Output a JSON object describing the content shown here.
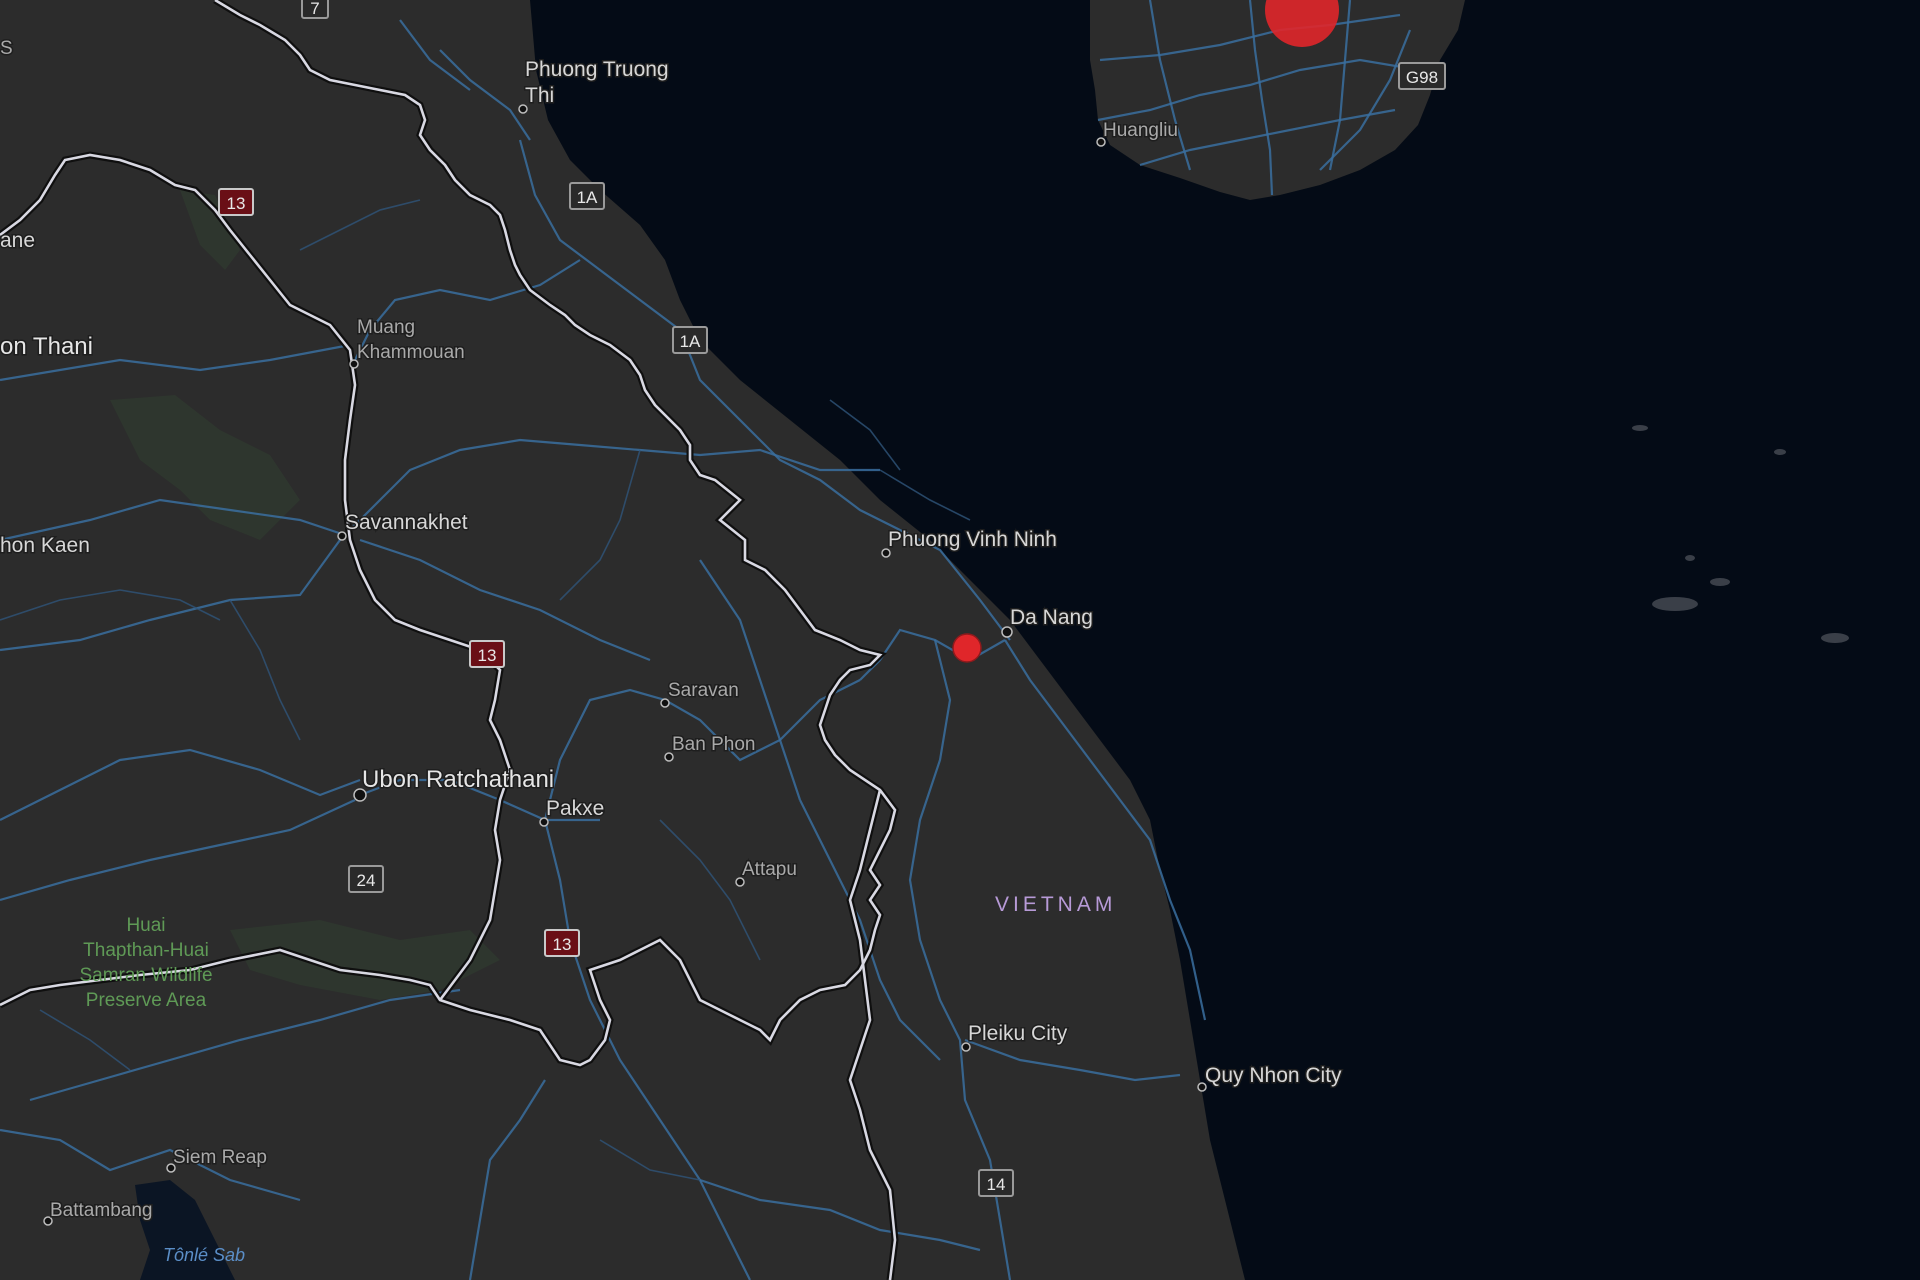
{
  "colors": {
    "sea": "#040b16",
    "land": "#2c2c2c",
    "roads": "#3a6f9f",
    "border": "#d8d8e2",
    "marker": "#e0262a",
    "country_label": "#b79ad7",
    "park_label": "#5f9a56"
  },
  "cities": [
    {
      "id": "phuong-truong-thi",
      "line1": "Phuong Truong",
      "line2": "Thi"
    },
    {
      "id": "huangliu",
      "name": "Huangliu"
    },
    {
      "id": "muang-khammouan",
      "line1": "Muang",
      "line2": "Khammouan"
    },
    {
      "id": "savannakhet",
      "name": "Savannakhet"
    },
    {
      "id": "phuong-vinh-ninh",
      "name": "Phuong Vinh Ninh"
    },
    {
      "id": "da-nang",
      "name": "Da Nang"
    },
    {
      "id": "saravan",
      "name": "Saravan"
    },
    {
      "id": "ban-phon",
      "name": "Ban Phon"
    },
    {
      "id": "ubon-ratchathani",
      "name": "Ubon Ratchathani"
    },
    {
      "id": "pakxe",
      "name": "Pakxe"
    },
    {
      "id": "attapu",
      "name": "Attapu"
    },
    {
      "id": "pleiku-city",
      "name": "Pleiku City"
    },
    {
      "id": "quy-nhon-city",
      "name": "Quy Nhon City"
    },
    {
      "id": "siem-reap",
      "name": "Siem Reap"
    },
    {
      "id": "battambang",
      "name": "Battambang"
    },
    {
      "id": "udon-thani",
      "name": "on Thani"
    },
    {
      "id": "khon-kaen",
      "name": "hon Kaen"
    },
    {
      "id": "vientiane",
      "name": "ane"
    }
  ],
  "country": "VIETNAM",
  "park": [
    "Huai",
    "Thapthan-Huai",
    "Samran Wildlife",
    "Preserve Area"
  ],
  "water": "Tônlé Sab",
  "shields": [
    "7",
    "1A",
    "1A",
    "13",
    "13",
    "13",
    "24",
    "14",
    "G98"
  ],
  "markers": [
    {
      "id": "marker-hainan",
      "size": "large"
    },
    {
      "id": "marker-da-nang",
      "size": "small"
    }
  ],
  "edge_text": "S"
}
